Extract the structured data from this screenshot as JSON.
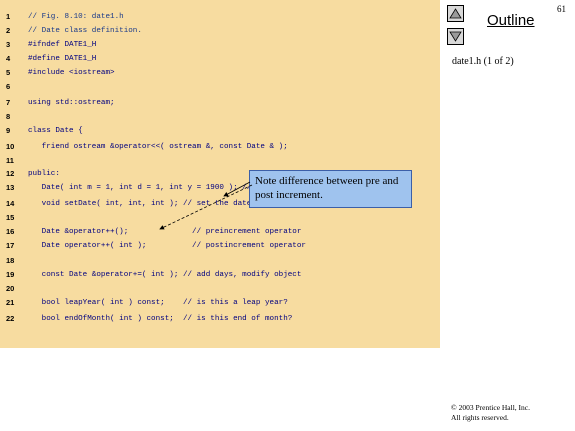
{
  "slide": {
    "page_number": "61",
    "outline_title": "Outline",
    "file_label": "date1.h (1 of 2)",
    "copyright_line1": "© 2003 Prentice Hall, Inc.",
    "copyright_line2": "All rights reserved."
  },
  "code_lines": [
    {
      "num": "1",
      "text": "// Fig. 8.10: date1.h",
      "comment": true
    },
    {
      "num": "2",
      "text": "// Date class definition.",
      "comment": true
    },
    {
      "num": "3",
      "text": "#ifndef DATE1_H",
      "comment": false
    },
    {
      "num": "4",
      "text": "#define DATE1_H",
      "comment": false
    },
    {
      "num": "5",
      "text": "#include <iostream>",
      "comment": false
    },
    {
      "num": "6",
      "text": "",
      "comment": false
    },
    {
      "num": "7",
      "text": "using std::ostream;",
      "comment": false
    },
    {
      "num": "8",
      "text": "",
      "comment": false
    },
    {
      "num": "9",
      "text": "class Date {",
      "comment": false
    },
    {
      "num": "10",
      "text": "   friend ostream &operator<<( ostream &, const Date & );",
      "comment": false
    },
    {
      "num": "11",
      "text": "",
      "comment": false
    },
    {
      "num": "12",
      "text": "public:",
      "comment": false
    },
    {
      "num": "13",
      "text": "   Date( int m = 1, int d = 1, int y = 1900 ); // constructor",
      "comment": false
    },
    {
      "num": "14",
      "text": "   void setDate( int, int, int ); // set the date",
      "comment": false
    },
    {
      "num": "15",
      "text": "",
      "comment": false
    },
    {
      "num": "16",
      "text": "   Date &operator++();              // preincrement operator",
      "comment": false
    },
    {
      "num": "17",
      "text": "   Date operator++( int );          // postincrement operator",
      "comment": false
    },
    {
      "num": "18",
      "text": "",
      "comment": false
    },
    {
      "num": "19",
      "text": "   const Date &operator+=( int ); // add days, modify object",
      "comment": false
    },
    {
      "num": "20",
      "text": "",
      "comment": false
    },
    {
      "num": "21",
      "text": "   bool leapYear( int ) const;    // is this a leap year?",
      "comment": false
    },
    {
      "num": "22",
      "text": "   bool endOfMonth( int ) const;  // is this end of month?",
      "comment": false
    }
  ],
  "callout": {
    "text": "Note difference between pre and post increment."
  },
  "colors": {
    "code_background": "#f7dca0",
    "callout_background": "#9fc3ee",
    "code_text": "#000080"
  },
  "icons": {
    "up": "triangle-up-icon",
    "down": "triangle-down-icon"
  }
}
